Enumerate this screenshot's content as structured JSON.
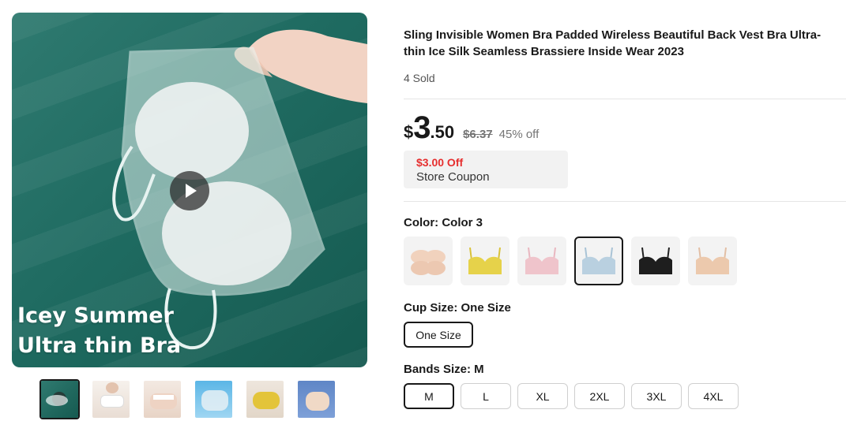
{
  "product": {
    "title": "Sling Invisible Women Bra Padded Wireless Beautiful Back Vest Bra Ultra-thin Ice Silk Seamless Brassiere Inside Wear 2023",
    "sold": "4 Sold"
  },
  "gallery": {
    "overlay_line1": "Icey Summer",
    "overlay_line2": "Ultra thin Bra",
    "play_icon": "play-icon",
    "thumbnails": 6,
    "active_thumbnail": 1
  },
  "price": {
    "currency": "$",
    "integer": "3",
    "decimal": ".50",
    "original": "$6.37",
    "discount": "45% off"
  },
  "coupon": {
    "amount": "$3.00 Off",
    "label": "Store Coupon"
  },
  "color": {
    "label": "Color: Color 3",
    "options": [
      "nude-pads",
      "yellow",
      "pink",
      "light-blue",
      "black",
      "beige"
    ],
    "selected": "light-blue"
  },
  "cup_size": {
    "label": "Cup Size: One Size",
    "options": [
      "One Size"
    ],
    "selected": "One Size"
  },
  "band_size": {
    "label": "Bands Size: M",
    "options": [
      "M",
      "L",
      "XL",
      "2XL",
      "3XL",
      "4XL"
    ],
    "selected": "M"
  },
  "colors": {
    "background_teal": "#1f6b61",
    "text_dark": "#191919",
    "coupon_red": "#e62e2e",
    "muted": "#757575"
  }
}
